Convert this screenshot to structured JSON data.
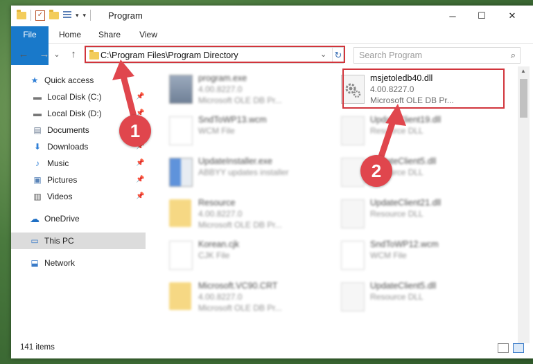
{
  "window": {
    "title": "Program"
  },
  "qat": {
    "dropdown_glyph": "▾",
    "chevron": "▾"
  },
  "window_controls": {
    "minimize": "─",
    "maximize": "☐",
    "close": "✕"
  },
  "ribbon_tabs": [
    {
      "label": "File"
    },
    {
      "label": "Home"
    },
    {
      "label": "Share"
    },
    {
      "label": "View"
    }
  ],
  "nav": {
    "back": "←",
    "forward": "→",
    "recent": "⌄",
    "up": "↑",
    "address": "C:\\Program Files\\Program Directory",
    "dropdown": "⌄",
    "refresh": "↻",
    "search_placeholder": "Search Program",
    "search_icon": "⌕"
  },
  "sidebar": {
    "items": [
      {
        "label": "Quick access",
        "icon": "star-icon",
        "glyph": "★"
      },
      {
        "label": "Local Disk (C:)",
        "icon": "drive-icon",
        "glyph": "▬",
        "pinned": true
      },
      {
        "label": "Local Disk (D:)",
        "icon": "drive-icon",
        "glyph": "▬",
        "pinned": true
      },
      {
        "label": "Documents",
        "icon": "documents-icon",
        "glyph": "▤",
        "pinned": true
      },
      {
        "label": "Downloads",
        "icon": "downloads-icon",
        "glyph": "⬇",
        "pinned": true
      },
      {
        "label": "Music",
        "icon": "music-icon",
        "glyph": "♪",
        "pinned": true
      },
      {
        "label": "Pictures",
        "icon": "pictures-icon",
        "glyph": "▣",
        "pinned": true
      },
      {
        "label": "Videos",
        "icon": "videos-icon",
        "glyph": "▥",
        "pinned": true
      },
      {
        "label": "OneDrive",
        "icon": "cloud-icon",
        "glyph": "☁"
      },
      {
        "label": "This PC",
        "icon": "computer-icon",
        "glyph": "▭",
        "selected": true
      },
      {
        "label": "Network",
        "icon": "network-icon",
        "glyph": "⬓"
      }
    ],
    "pin_glyph": "📌"
  },
  "files": [
    {
      "name": "program.exe",
      "meta1": "4.00.8227.0",
      "meta2": "Microsoft OLE DB Pr...",
      "kind": "exe"
    },
    {
      "name": "msjetoledb40.dll",
      "meta1": "4.00.8227.0",
      "meta2": "Microsoft OLE DB Pr...",
      "kind": "dll",
      "highlighted": true
    },
    {
      "name": "SndToWP13.wcm",
      "meta1": "WCM File",
      "meta2": "",
      "kind": "doc"
    },
    {
      "name": "UpdateClient19.dll",
      "meta1": "Resource DLL",
      "meta2": "",
      "kind": "dll"
    },
    {
      "name": "UpdateInstaller.exe",
      "meta1": "ABBYY updates installer",
      "meta2": "",
      "kind": "exe2"
    },
    {
      "name": "UpdateClient5.dll",
      "meta1": "Resource DLL",
      "meta2": "",
      "kind": "dll"
    },
    {
      "name": "Resource",
      "meta1": "4.00.8227.0",
      "meta2": "Microsoft OLE DB Pr...",
      "kind": "folder"
    },
    {
      "name": "UpdateClient21.dll",
      "meta1": "Resource DLL",
      "meta2": "",
      "kind": "dll"
    },
    {
      "name": "Korean.cjk",
      "meta1": "CJK File",
      "meta2": "",
      "kind": "doc"
    },
    {
      "name": "SndToWP12.wcm",
      "meta1": "WCM File",
      "meta2": "",
      "kind": "doc"
    },
    {
      "name": "Microsoft.VC90.CRT",
      "meta1": "4.00.8227.0",
      "meta2": "Microsoft OLE DB Pr...",
      "kind": "folder"
    },
    {
      "name": "UpdateClient5.dll",
      "meta1": "Resource DLL",
      "meta2": "",
      "kind": "dll"
    }
  ],
  "status": {
    "item_count": "141 items"
  },
  "annotations": [
    {
      "label": "1"
    },
    {
      "label": "2"
    }
  ],
  "colors": {
    "accent": "#1979ca",
    "highlight": "#d1343b",
    "callout": "#e0464d"
  }
}
